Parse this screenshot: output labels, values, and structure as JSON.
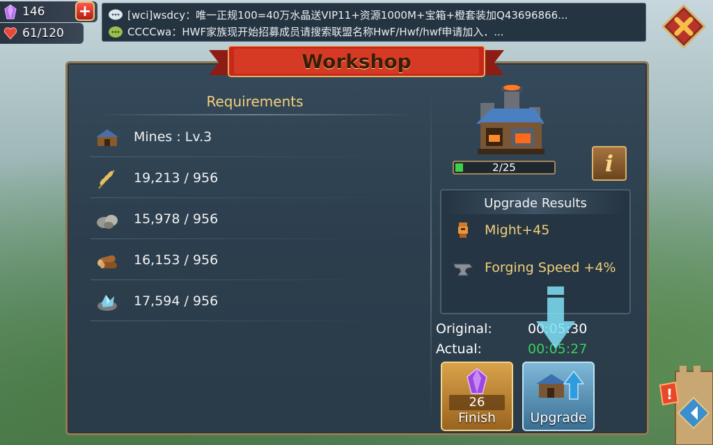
{
  "hud": {
    "gems": "146",
    "hp": "61/120"
  },
  "chat": [
    {
      "text": "[wci]wsdcy：唯一正规100=40万水晶送VIP11+资源1000M+宝箱+橙套装加Q43696866..."
    },
    {
      "text": "CCCCwa：HWF家族现开始招募成员请搜索联盟名称HwF/Hwf/hwf申请加入．..."
    }
  ],
  "title": "Workshop",
  "requirements": {
    "title": "Requirements",
    "items": [
      {
        "icon": "workshop-building-icon",
        "text": "Mines : Lv.3"
      },
      {
        "icon": "wheat-icon",
        "text": "19,213 / 956"
      },
      {
        "icon": "stone-icon",
        "text": "15,978 / 956"
      },
      {
        "icon": "timber-icon",
        "text": "16,153 / 956"
      },
      {
        "icon": "ore-icon",
        "text": "17,594 / 956"
      }
    ]
  },
  "building": {
    "level": "2/25",
    "progress": 0.08
  },
  "upgrade_results": {
    "title": "Upgrade Results",
    "items": [
      {
        "icon": "might-icon",
        "text": "Might+45"
      },
      {
        "icon": "anvil-icon",
        "text": "Forging Speed +4%"
      }
    ]
  },
  "times": {
    "original_label": "Original:",
    "original_value": "00:05:30",
    "actual_label": "Actual:",
    "actual_value": "00:05:27"
  },
  "buttons": {
    "finish_label": "Finish",
    "finish_cost": "26",
    "upgrade_label": "Upgrade"
  },
  "colors": {
    "accent_gold": "#f6d17a",
    "actual_time": "#39d25a",
    "banner_red": "#c8281c"
  }
}
